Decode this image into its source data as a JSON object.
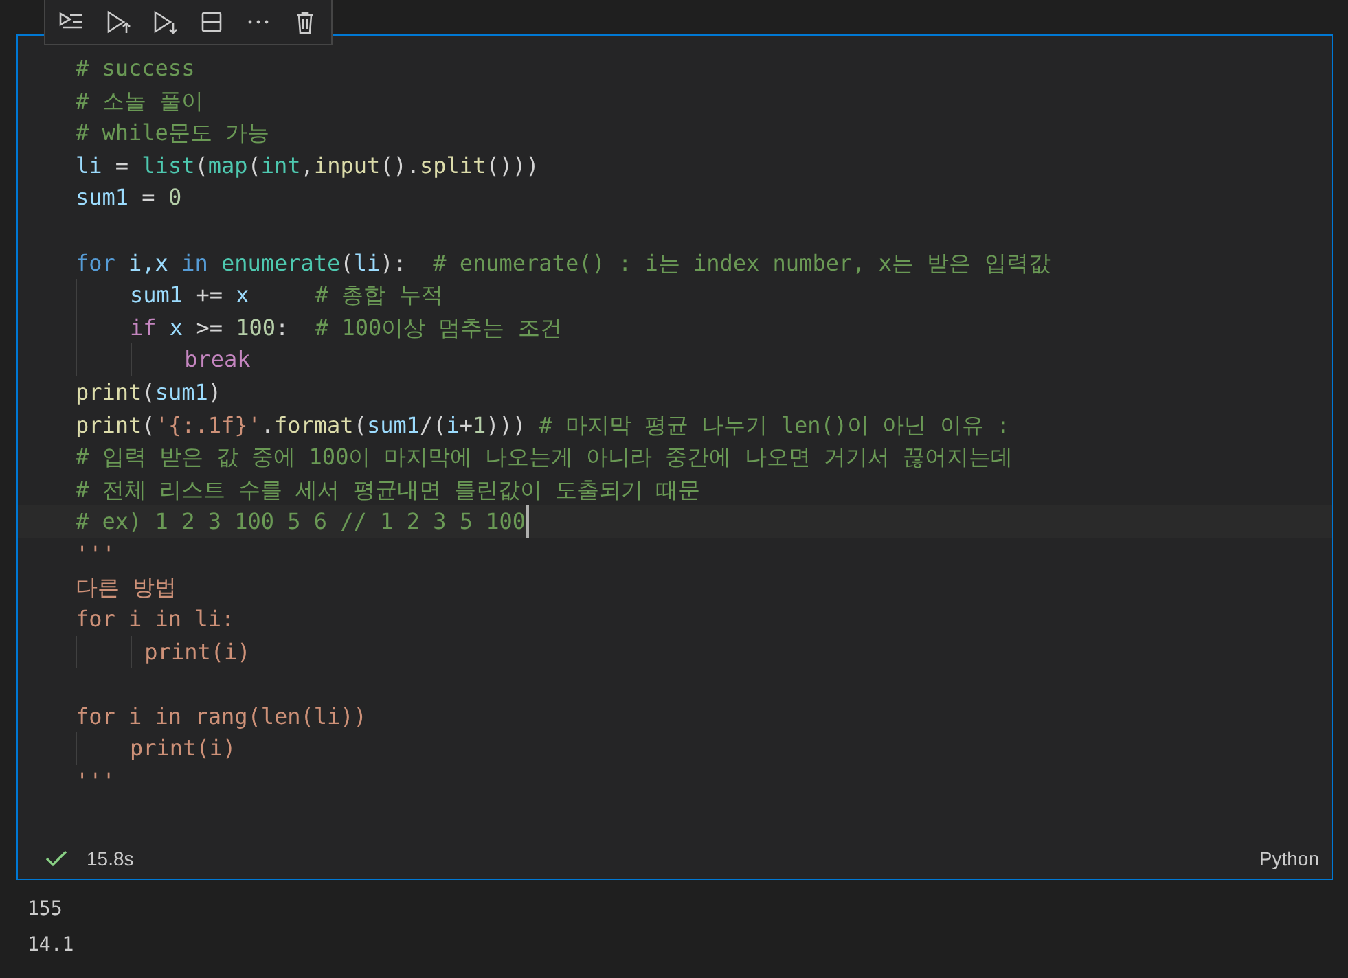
{
  "cell": {
    "lines": [
      {
        "kind": "code",
        "current": false,
        "tokens": [
          {
            "text": "# success",
            "kind": "comment"
          }
        ]
      },
      {
        "kind": "code",
        "current": false,
        "tokens": [
          {
            "text": "# 소놀 풀이",
            "kind": "comment"
          }
        ]
      },
      {
        "kind": "code",
        "current": false,
        "tokens": [
          {
            "text": "# while문도 가능",
            "kind": "comment"
          }
        ]
      },
      {
        "kind": "code",
        "current": false,
        "tokens": [
          {
            "text": "li",
            "kind": "variable"
          },
          {
            "text": " = ",
            "kind": "plain"
          },
          {
            "text": "list",
            "kind": "builtin"
          },
          {
            "text": "(",
            "kind": "plain"
          },
          {
            "text": "map",
            "kind": "builtin"
          },
          {
            "text": "(",
            "kind": "plain"
          },
          {
            "text": "int",
            "kind": "builtin"
          },
          {
            "text": ",",
            "kind": "plain"
          },
          {
            "text": "input",
            "kind": "function"
          },
          {
            "text": "().",
            "kind": "plain"
          },
          {
            "text": "split",
            "kind": "function"
          },
          {
            "text": "()))",
            "kind": "plain"
          }
        ]
      },
      {
        "kind": "code",
        "current": false,
        "tokens": [
          {
            "text": "sum1",
            "kind": "variable"
          },
          {
            "text": " = ",
            "kind": "plain"
          },
          {
            "text": "0",
            "kind": "number"
          }
        ]
      },
      {
        "kind": "blank"
      },
      {
        "kind": "code",
        "current": false,
        "tokens": [
          {
            "text": "for",
            "kind": "keyword"
          },
          {
            "text": " i,x ",
            "kind": "variable"
          },
          {
            "text": "in",
            "kind": "keyword"
          },
          {
            "text": " enumerate",
            "kind": "builtin"
          },
          {
            "text": "(",
            "kind": "plain"
          },
          {
            "text": "li",
            "kind": "variable"
          },
          {
            "text": "):  ",
            "kind": "plain"
          },
          {
            "text": "# enumerate() : i는 index number, x는 받은 입력값",
            "kind": "comment"
          }
        ]
      },
      {
        "kind": "code",
        "current": false,
        "tokens": [
          {
            "text": "    sum1",
            "kind": "variable"
          },
          {
            "text": " += ",
            "kind": "plain"
          },
          {
            "text": "x",
            "kind": "variable"
          },
          {
            "text": "     # 총합 누적",
            "kind": "comment"
          }
        ]
      },
      {
        "kind": "code",
        "current": false,
        "tokens": [
          {
            "text": "    if",
            "kind": "control"
          },
          {
            "text": " x ",
            "kind": "variable"
          },
          {
            "text": ">= ",
            "kind": "plain"
          },
          {
            "text": "100",
            "kind": "number"
          },
          {
            "text": ":  ",
            "kind": "plain"
          },
          {
            "text": "# 100이상 멈추는 조건",
            "kind": "comment"
          }
        ]
      },
      {
        "kind": "code",
        "current": false,
        "tokens": [
          {
            "text": "        break",
            "kind": "control"
          }
        ]
      },
      {
        "kind": "code",
        "current": false,
        "tokens": [
          {
            "text": "print",
            "kind": "function"
          },
          {
            "text": "(",
            "kind": "plain"
          },
          {
            "text": "sum1",
            "kind": "variable"
          },
          {
            "text": ")",
            "kind": "plain"
          }
        ]
      },
      {
        "kind": "code",
        "current": false,
        "tokens": [
          {
            "text": "print",
            "kind": "function"
          },
          {
            "text": "(",
            "kind": "plain"
          },
          {
            "text": "'{:.1f}'",
            "kind": "string"
          },
          {
            "text": ".",
            "kind": "plain"
          },
          {
            "text": "format",
            "kind": "function"
          },
          {
            "text": "(",
            "kind": "plain"
          },
          {
            "text": "sum1",
            "kind": "variable"
          },
          {
            "text": "/(",
            "kind": "plain"
          },
          {
            "text": "i",
            "kind": "variable"
          },
          {
            "text": "+",
            "kind": "plain"
          },
          {
            "text": "1",
            "kind": "number"
          },
          {
            "text": "))) ",
            "kind": "plain"
          },
          {
            "text": "# 마지막 평균 나누기 len()이 아닌 이유 :",
            "kind": "comment"
          }
        ]
      },
      {
        "kind": "code",
        "current": false,
        "tokens": [
          {
            "text": "# 입력 받은 값 중에 100이 마지막에 나오는게 아니라 중간에 나오면 거기서 끊어지는데",
            "kind": "comment"
          }
        ]
      },
      {
        "kind": "code",
        "current": false,
        "tokens": [
          {
            "text": "# 전체 리스트 수를 세서 평균내면 틀린값이 도출되기 때문",
            "kind": "comment"
          }
        ]
      },
      {
        "kind": "code",
        "current": true,
        "tokens": [
          {
            "text": "# ex) 1 2 3 100 5 6 // 1 2 3 5 100",
            "kind": "comment"
          }
        ]
      },
      {
        "kind": "code",
        "current": false,
        "tokens": [
          {
            "text": "'''",
            "kind": "string"
          }
        ]
      },
      {
        "kind": "code",
        "current": false,
        "tokens": [
          {
            "text": "다른 방법",
            "kind": "string"
          }
        ]
      },
      {
        "kind": "code",
        "current": false,
        "tokens": [
          {
            "text": "for i in li:",
            "kind": "string"
          }
        ]
      },
      {
        "kind": "code",
        "current": false,
        "tokens": [
          {
            "text": "     print(i)",
            "kind": "string"
          }
        ]
      },
      {
        "kind": "blank"
      },
      {
        "kind": "code",
        "current": false,
        "tokens": [
          {
            "text": "for i in rang(len(li))",
            "kind": "string"
          }
        ]
      },
      {
        "kind": "code",
        "current": false,
        "tokens": [
          {
            "text": "    print(i)",
            "kind": "string"
          }
        ]
      },
      {
        "kind": "code",
        "current": false,
        "tokens": [
          {
            "text": "'''",
            "kind": "string"
          }
        ]
      }
    ],
    "status": {
      "succeeded": true,
      "duration": "15.8s",
      "language": "Python"
    }
  },
  "outputs": [
    "155",
    "14.1"
  ]
}
